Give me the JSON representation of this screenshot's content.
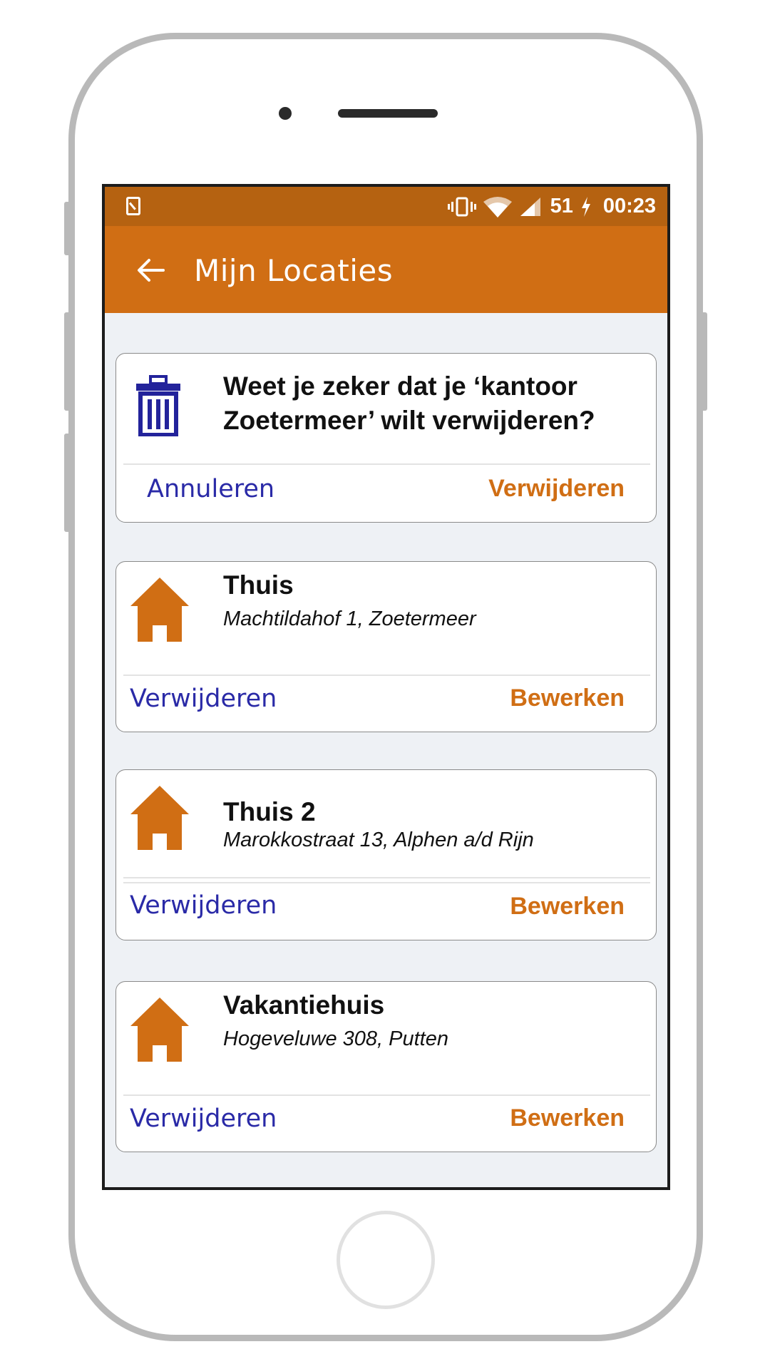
{
  "status_bar": {
    "battery": "51",
    "time": "00:23"
  },
  "app_bar": {
    "title": "Mijn Locaties"
  },
  "confirm_dialog": {
    "message": "Weet je zeker dat je ‘kantoor Zoetermeer’ wilt verwijderen?",
    "cancel_label": "Annuleren",
    "confirm_label": "Verwijderen"
  },
  "locations": [
    {
      "name": "Thuis",
      "address": "Machtildahof 1, Zoetermeer",
      "delete_label": "Verwijderen",
      "edit_label": "Bewerken"
    },
    {
      "name": "Thuis 2",
      "address": "Marokkostraat 13, Alphen a/d Rijn",
      "delete_label": "Verwijderen",
      "edit_label": "Bewerken"
    },
    {
      "name": "Vakantiehuis",
      "address": "Hogeveluwe 308, Putten",
      "delete_label": "Verwijderen",
      "edit_label": "Bewerken"
    }
  ],
  "colors": {
    "status_bar": "#b56211",
    "app_bar": "#d06e14",
    "accent_orange": "#d06e14",
    "link_blue": "#2a2aa7",
    "trash_blue": "#23239b",
    "background": "#eef1f5"
  },
  "icons": {
    "back": "arrow-left-icon",
    "trash": "trash-icon",
    "location": "house-icon"
  }
}
